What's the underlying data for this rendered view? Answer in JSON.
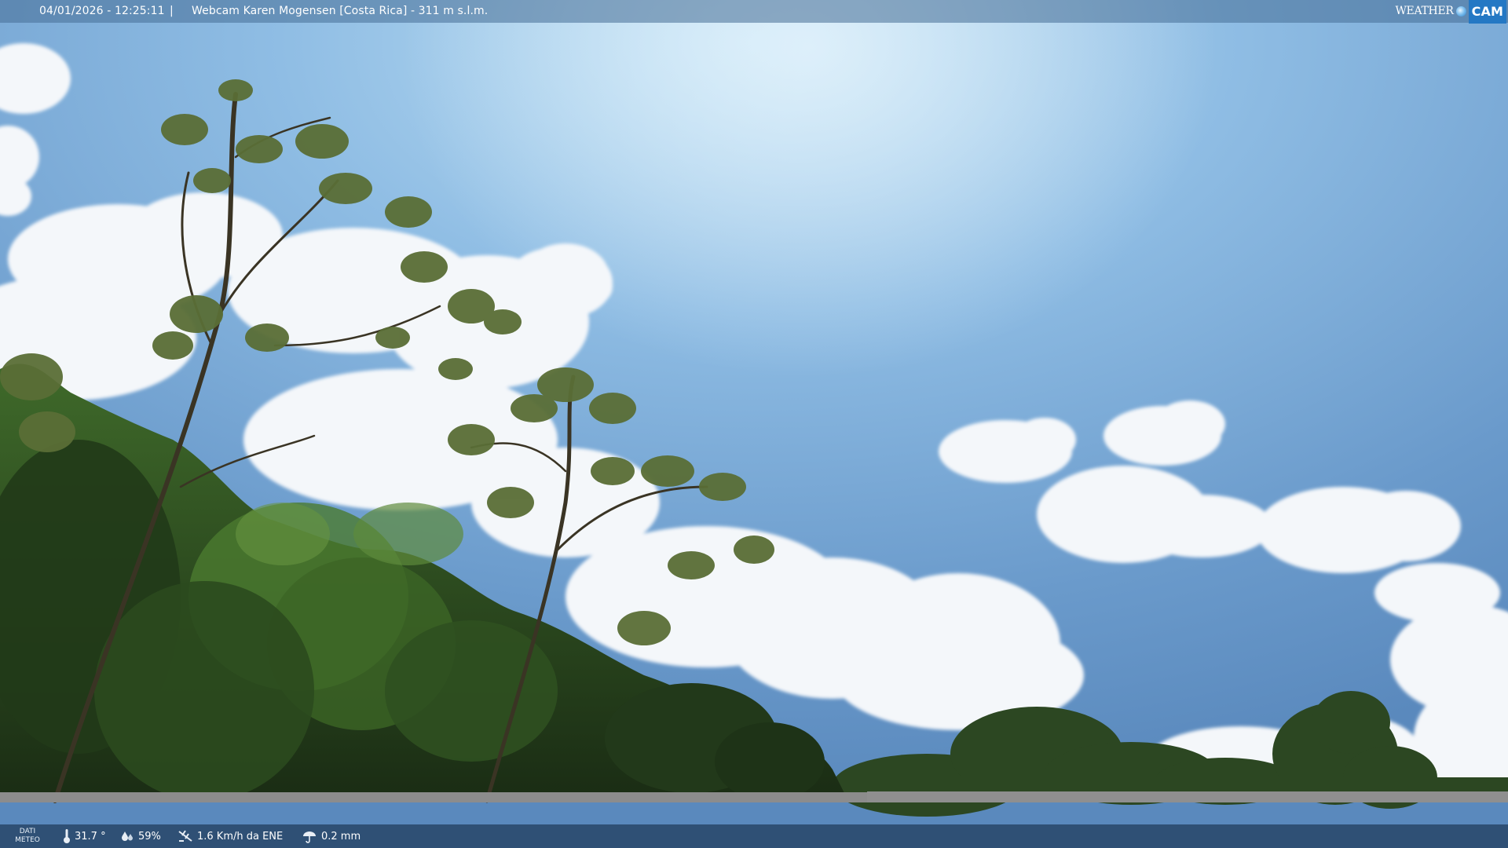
{
  "header": {
    "timestamp": "04/01/2026 - 12:25:11",
    "separator": "|",
    "title": "Webcam Karen Mogensen [Costa Rica]  - 311 m s.l.m.",
    "logo_weather": "WEATHER",
    "logo_cam": "CAM"
  },
  "footer": {
    "dati_line1": "DATI",
    "dati_line2": "METEO",
    "temperature": "31.7 °",
    "humidity": "59%",
    "wind": "1.6 Km/h da ENE",
    "rain": "0.2 mm"
  },
  "icons": {
    "temperature": "thermometer-icon",
    "humidity": "humidity-drops-icon",
    "wind": "wind-icon",
    "rain": "rain-icon"
  },
  "colors": {
    "sky_top": "#b9dbf1",
    "sky_mid": "#7aa8d6",
    "sky_bottom": "#5f8fc2",
    "foliage_dark": "#1f3418",
    "foliage_light": "#5e8a3c",
    "logo_blue": "#2478c4"
  }
}
